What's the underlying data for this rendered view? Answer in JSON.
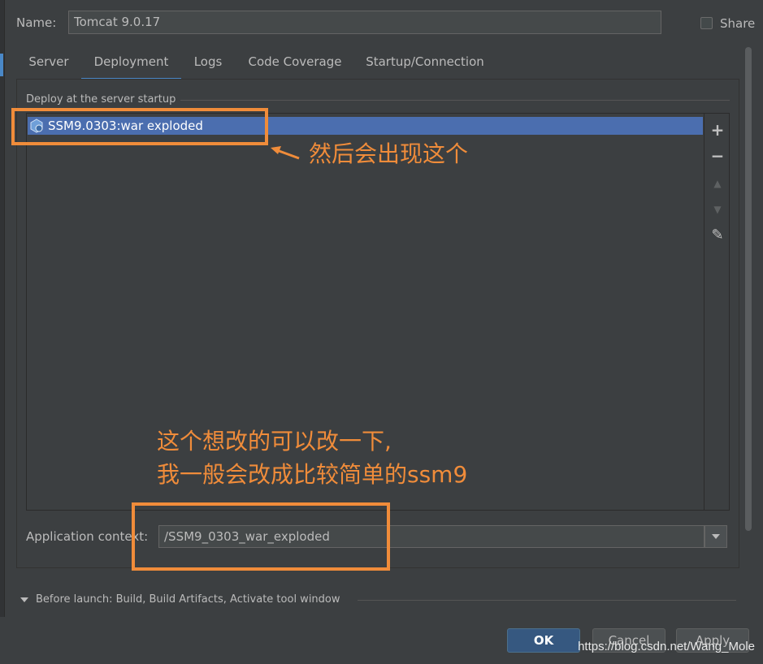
{
  "header": {
    "name_label": "Name:",
    "name_value": "Tomcat 9.0.17",
    "share_label": "Share"
  },
  "tabs": [
    {
      "label": "Server"
    },
    {
      "label": "Deployment",
      "active": true
    },
    {
      "label": "Logs"
    },
    {
      "label": "Code Coverage"
    },
    {
      "label": "Startup/Connection"
    }
  ],
  "deploy": {
    "section_title": "Deploy at the server startup",
    "items": [
      {
        "label": "SSM9.0303:war exploded",
        "selected": true
      }
    ],
    "toolbar": [
      {
        "icon": "plus-icon",
        "glyph": "+",
        "enabled": true
      },
      {
        "icon": "minus-icon",
        "glyph": "−",
        "enabled": true
      },
      {
        "icon": "move-up-icon",
        "glyph": "▲",
        "enabled": false
      },
      {
        "icon": "move-down-icon",
        "glyph": "▼",
        "enabled": false
      },
      {
        "icon": "edit-icon",
        "glyph": "✎",
        "enabled": true
      }
    ]
  },
  "context": {
    "label": "Application context:",
    "value": "/SSM9_0303_war_exploded"
  },
  "before_launch": {
    "text": "Before launch: Build, Build Artifacts, Activate tool window"
  },
  "buttons": {
    "ok": "OK",
    "cancel": "Cancel",
    "apply": "Apply"
  },
  "annotations": {
    "note1": "然后会出现这个",
    "note2_line1": "这个想改的可以改一下,",
    "note2_line2": "我一般会改成比较简单的ssm9"
  },
  "watermark": "https://blog.csdn.net/Wang_Mole",
  "colors": {
    "background": "#3c3f41",
    "accent": "#4a88c7",
    "selection": "#4b6eaf",
    "annotation": "#f08c3a",
    "primary_button": "#365880"
  }
}
